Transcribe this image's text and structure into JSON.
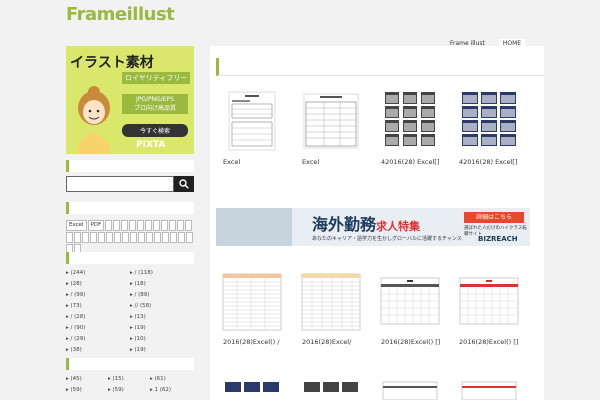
{
  "site": {
    "logo": "Frameillust"
  },
  "breadcrumbs": [
    "Frame illust",
    "HOME"
  ],
  "banner": {
    "headline": "イラスト素材",
    "tagline": "ロイヤリティフリー",
    "formats": "JPG/PNG/EPS",
    "quality": "プロ向け高品質",
    "cta": "今すぐ検索",
    "brand": "PIXTA"
  },
  "search": {
    "placeholder": "",
    "icon": "search-icon"
  },
  "tags": [
    "Excel",
    "PDF"
  ],
  "categories1": [
    [
      "(244)",
      "/ (118)"
    ],
    [
      "(28)",
      "(18)"
    ],
    [
      "/ (99)",
      "/ (89)"
    ],
    [
      "(73)",
      "// (58)"
    ],
    [
      "/ (28)",
      "(13)"
    ],
    [
      "/ (90)",
      "(19)"
    ],
    [
      "/ (29)",
      "(10)"
    ],
    [
      "(38)",
      "(19)"
    ]
  ],
  "categories2": [
    [
      "(45)",
      "(15)",
      "(61)"
    ],
    [
      "(59)",
      "(59)",
      "1 (62)"
    ],
    [
      "(28)",
      "(55)",
      "(18)"
    ]
  ],
  "main": {
    "row1_captions": [
      "Excel",
      "Excel",
      "42016(28) Excel[]",
      "42016(28) Excel[]"
    ],
    "row2_captions": [
      "2016(28)Excel() /",
      "2016(28)Excel/",
      "2016(28)Excel() []",
      "2016(28)Excel() []"
    ]
  },
  "ad": {
    "headline": "海外勤務",
    "headline_suffix": "求人特集",
    "subtext": "あなたのキャリア・語学力を生かしグローバルに活躍するチャンス",
    "button": "詳細はこちら",
    "subtext2": "選ばれた人だけのハイクラス転職サイト",
    "brand": "BIZREACH"
  },
  "colors": {
    "accent": "#9ab93f",
    "banner_bg": "#d9e86a",
    "ad_red": "#e7472a"
  }
}
